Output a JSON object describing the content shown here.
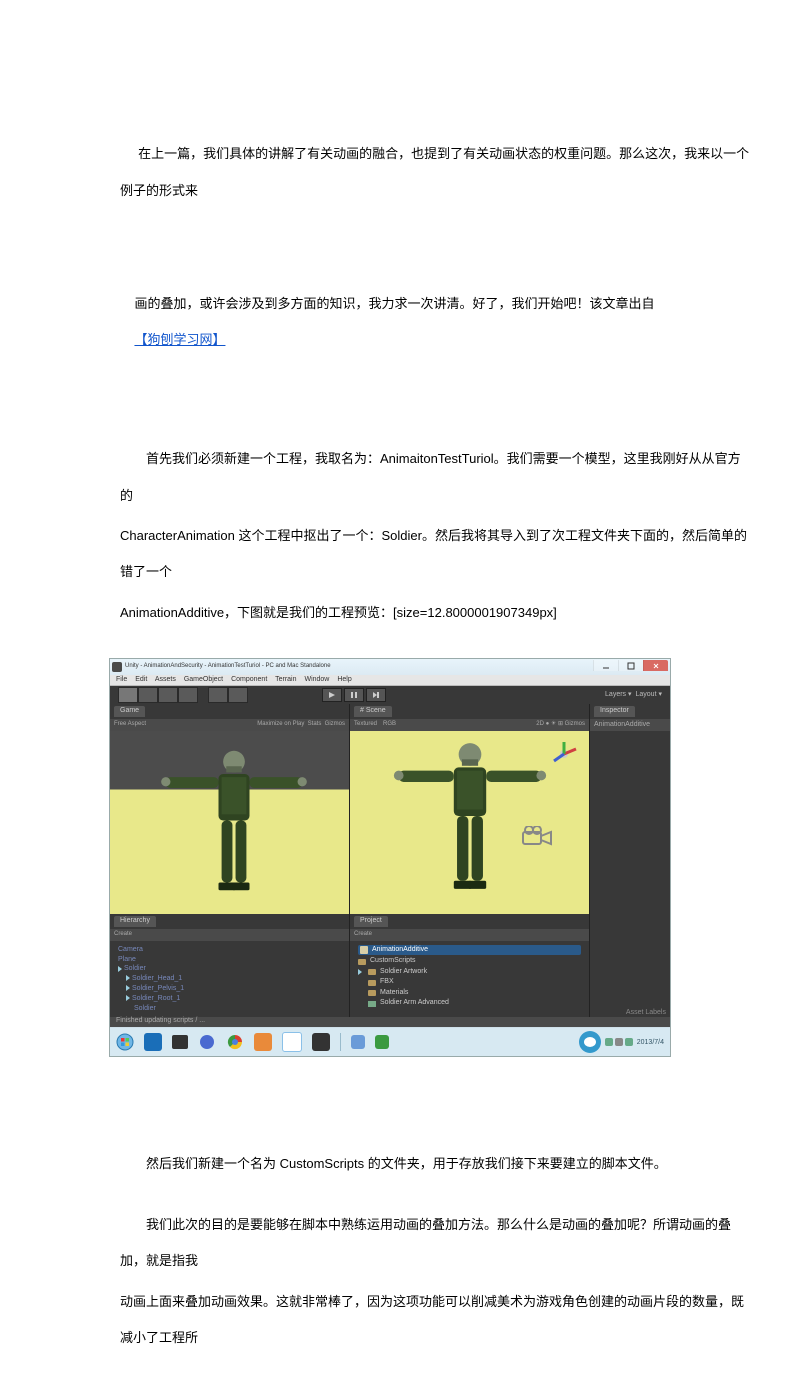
{
  "text": {
    "p1_a": " 在上一篇，我们具体的讲解了有关动画的融合，也提到了有关动画状态的权重问题。那么这次，我来以一个例子的形式来",
    "p1_b": "画的叠加，或许会涉及到多方面的知识，我力求一次讲清。好了，我们开始吧！该文章出自",
    "link_label": "【狗刨学习网】",
    "p2": "首先我们必须新建一个工程，我取名为：AnimaitonTestTuriol。我们需要一个模型，这里我刚好从从官方的",
    "p3": "CharacterAnimation 这个工程中抠出了一个：Soldier。然后我将其导入到了次工程文件夹下面的，然后简单的错了一个",
    "p4": "AnimationAdditive，下图就是我们的工程预览：[size=12.8000001907349px]",
    "p5": "然后我们新建一个名为 CustomScripts 的文件夹，用于存放我们接下来要建立的脚本文件。",
    "p6": "我们此次的目的是要能够在脚本中熟练运用动画的叠加方法。那么什么是动画的叠加呢？所谓动画的叠加，就是指我",
    "p7": "动画上面来叠加动画效果。这就非常棒了，因为这项功能可以削减美术为游戏角色创建的动画片段的数量，既减小了工程所"
  },
  "window": {
    "title": "Unity - AnimationAndSecurity - AnimationTestTuriol - PC and Mac Standalone"
  },
  "menu": {
    "items": [
      "File",
      "Edit",
      "Assets",
      "GameObject",
      "Component",
      "Terrain",
      "Window",
      "Help"
    ]
  },
  "tabs": {
    "scene": "# Scene",
    "game": "Game",
    "free_aspect": "Free Aspect",
    "inspector": "Inspector",
    "hierarchy": "Hierarchy",
    "project": "Project",
    "rgb": "RGB"
  },
  "inspector_header": "AnimationAdditive",
  "asset_label": "Asset Labels",
  "hierarchy": {
    "create": "Create",
    "items": [
      "Camera",
      "Plane",
      "Soldier",
      "Soldier_Head_1",
      "Soldier_Pelvis_1",
      "Soldier_Root_1",
      "Soldier"
    ]
  },
  "project": {
    "create": "Create",
    "items": [
      "AnimationAdditive",
      "CustomScripts",
      "Soldier Artwork",
      "FBX",
      "Materials",
      "Soldier Arm Advanced"
    ]
  },
  "statusbar": "Finished updating scripts / ...",
  "taskbar": {
    "time": "2013/7/4"
  }
}
